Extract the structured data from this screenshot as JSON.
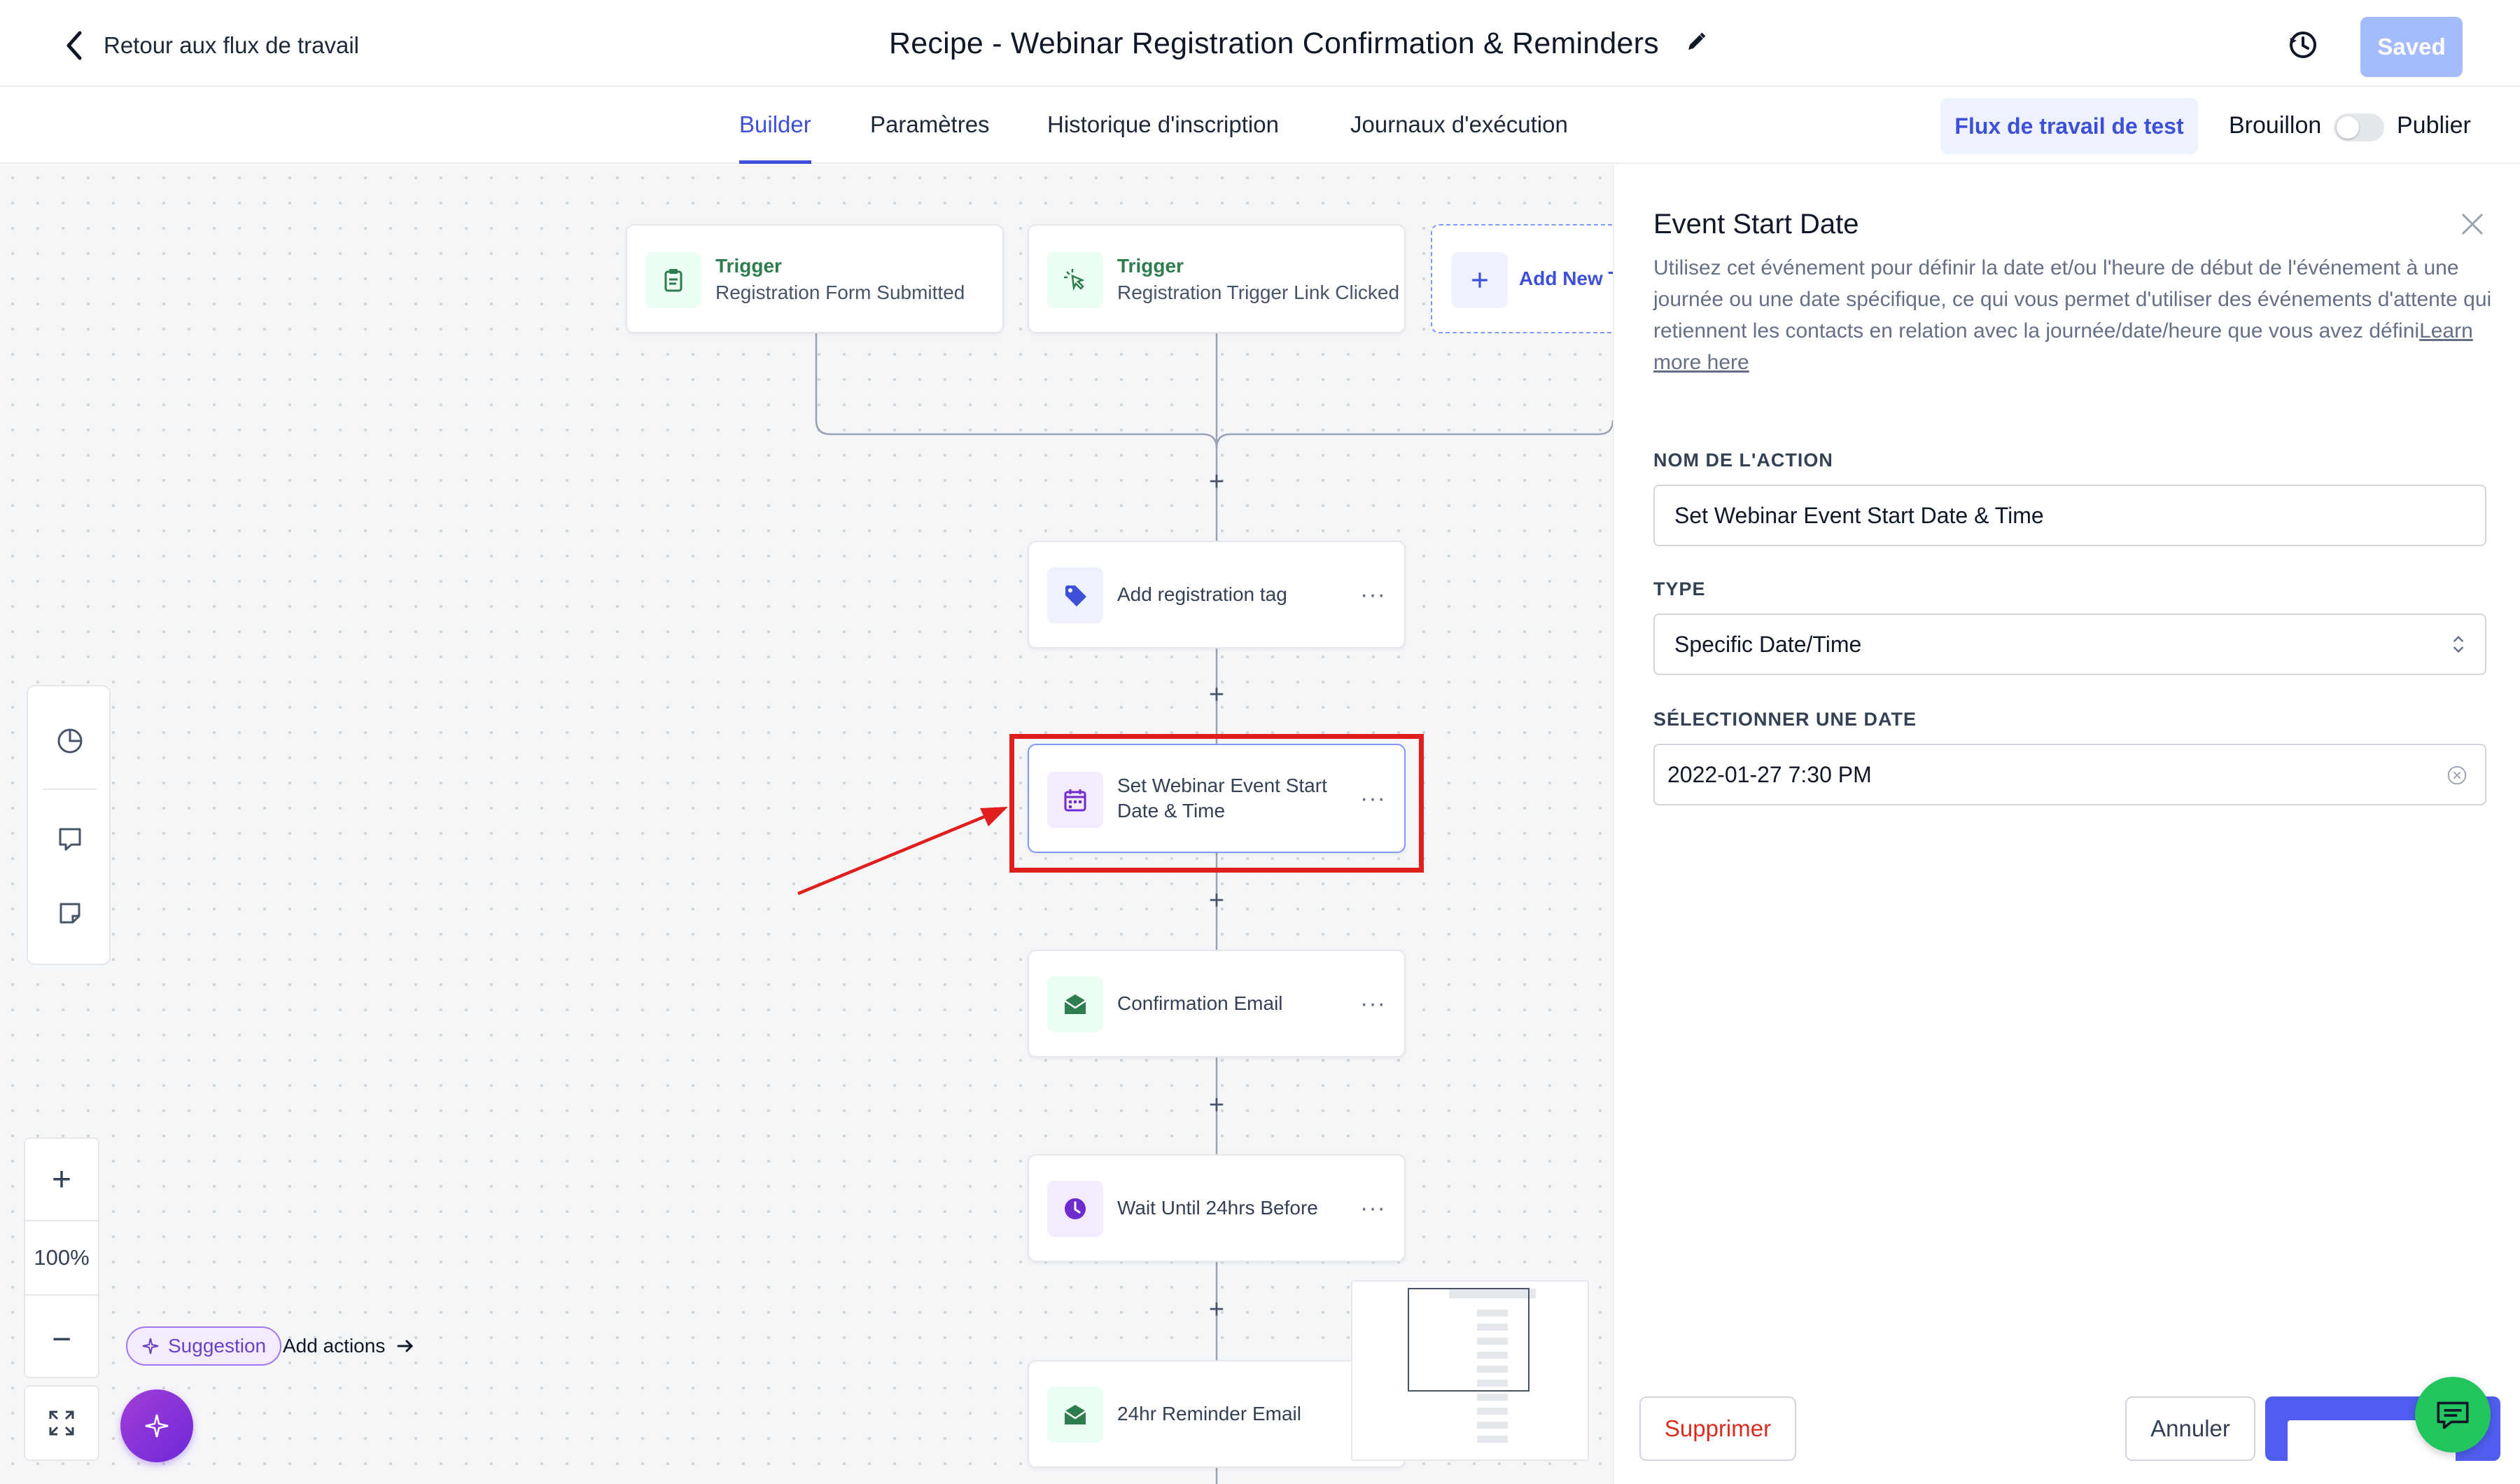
{
  "header": {
    "back_label": "Retour aux flux de travail",
    "title": "Recipe - Webinar Registration Confirmation & Reminders",
    "saved_label": "Saved"
  },
  "tabs": [
    {
      "label": "Builder",
      "active": true
    },
    {
      "label": "Paramètres",
      "active": false
    },
    {
      "label": "Historique d'inscription",
      "active": false
    },
    {
      "label": "Journaux d'exécution",
      "active": false
    }
  ],
  "toolbar": {
    "test_workflow_label": "Flux de travail de test",
    "draft_label": "Brouillon",
    "publish_label": "Publier",
    "published": false
  },
  "canvas": {
    "triggers": [
      {
        "kicker": "Trigger",
        "label": "Registration Form Submitted",
        "icon": "clipboard-icon"
      },
      {
        "kicker": "Trigger",
        "label": "Registration Trigger Link Clicked",
        "icon": "cursor-click-icon"
      }
    ],
    "add_trigger_label": "Add New T",
    "actions": [
      {
        "label": "Add registration tag",
        "icon": "tag-icon"
      },
      {
        "label": "Set Webinar Event Start Date & Time",
        "icon": "calendar-icon",
        "selected": true
      },
      {
        "label": "Confirmation Email",
        "icon": "email-icon"
      },
      {
        "label": "Wait Until 24hrs Before",
        "icon": "clock-icon"
      },
      {
        "label": "24hr Reminder Email",
        "icon": "email-icon"
      }
    ],
    "zoom": "100%",
    "suggestion_label": "Suggestion",
    "add_actions_label": "Add actions"
  },
  "panel": {
    "title": "Event Start Date",
    "description": "Utilisez cet événement pour définir la date et/ou l'heure de début de l'événement à une journée ou une date spécifique, ce qui vous permet d'utiliser des événements d'attente qui retiennent les contacts en relation avec la journée/date/heure que vous avez défini",
    "learn_more": "Learn more here",
    "action_name_label": "NOM DE L'ACTION",
    "action_name_value": "Set Webinar Event Start Date & Time",
    "type_label": "TYPE",
    "type_value": "Specific Date/Time",
    "date_label": "SÉLECTIONNER UNE DATE",
    "date_value": "2022-01-27 7:30 PM",
    "delete_label": "Supprimer",
    "cancel_label": "Annuler"
  },
  "colors": {
    "accent": "#3e4fd8",
    "highlight": "#e01e1e",
    "trigger_green": "#2e7d4f",
    "action_purple": "#6e2ccf"
  }
}
